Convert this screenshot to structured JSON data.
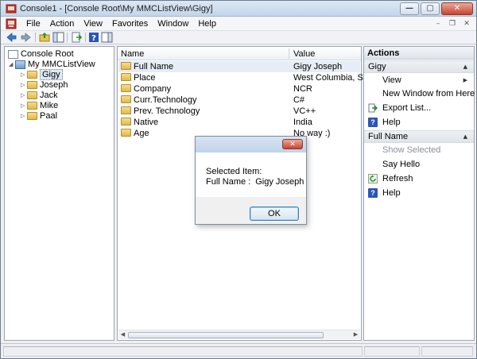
{
  "window": {
    "title": "Console1 - [Console Root\\My MMCListView\\Gigy]",
    "minimize_glyph": "—",
    "maximize_glyph": "▢",
    "close_glyph": "✕"
  },
  "menubar": {
    "items": [
      "File",
      "Action",
      "View",
      "Favorites",
      "Window",
      "Help"
    ],
    "mdi_minimize": "–",
    "mdi_restore": "❐",
    "mdi_close": "✕"
  },
  "tree": {
    "root": "Console Root",
    "snapin": "My MMCListView",
    "children": [
      "Gigy",
      "Joseph",
      "Jack",
      "Mike",
      "Paal"
    ],
    "expanded_glyph": "◢",
    "collapsed_glyph": "▷"
  },
  "list": {
    "col_name": "Name",
    "col_value": "Value",
    "rows": [
      {
        "name": "Full Name",
        "value": "Gigy Joseph"
      },
      {
        "name": "Place",
        "value": "West Columbia, SC"
      },
      {
        "name": "Company",
        "value": "NCR"
      },
      {
        "name": "Curr.Technology",
        "value": "C#"
      },
      {
        "name": "Prev. Technology",
        "value": "VC++"
      },
      {
        "name": "Native",
        "value": "India"
      },
      {
        "name": "Age",
        "value": "No way :)"
      }
    ],
    "scroll_left": "◀",
    "scroll_right": "▶"
  },
  "actions": {
    "title": "Actions",
    "section1": "Gigy",
    "section1_items": [
      "View",
      "New Window from Here",
      "Export List...",
      "Help"
    ],
    "section2": "Full Name",
    "section2_items": [
      "Show Selected",
      "Say Hello",
      "Refresh",
      "Help"
    ],
    "caret": "▲",
    "submenu_arrow": "▶",
    "help_glyph": "?"
  },
  "dialog": {
    "close_glyph": "✕",
    "line1": "Selected Item:",
    "line2_label": "Full Name :",
    "line2_value": "Gigy Joseph",
    "ok_label": "OK"
  },
  "colors": {
    "title_gradient": "#c4d5ea",
    "close_red": "#c8442f",
    "selection": "#e6edf6",
    "help_blue": "#2b55b5"
  }
}
